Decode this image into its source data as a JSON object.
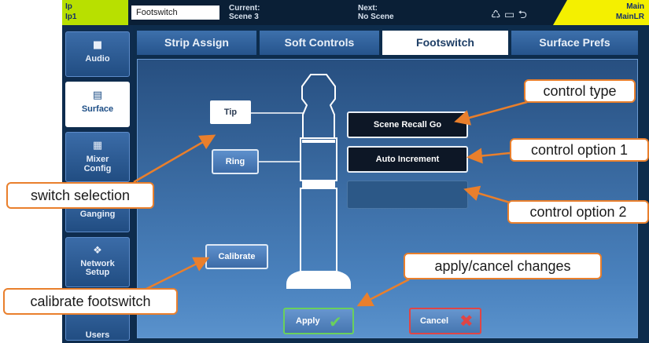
{
  "topbar": {
    "layer_top": "Ip",
    "layer_bottom": "Ip1",
    "screen_name": "Footswitch",
    "current_label": "Current:",
    "current_value": "Scene 3",
    "next_label": "Next:",
    "next_value": "No Scene",
    "status_icons": "♺ ▭ ⮌",
    "main_top": "Main",
    "main_bottom": "MainLR"
  },
  "nav": {
    "items": [
      {
        "label": "Audio",
        "icon": "audio-icon",
        "active": false
      },
      {
        "label": "Surface",
        "icon": "surface-icon",
        "active": true
      },
      {
        "label": "Mixer Config",
        "icon": "mixer-config-icon",
        "active": false
      },
      {
        "label": "Ganging",
        "icon": "ganging-icon",
        "active": false
      },
      {
        "label": "Network Setup",
        "icon": "network-icon",
        "active": false
      },
      {
        "label": "Users",
        "icon": "users-icon",
        "active": false
      }
    ]
  },
  "tabs": [
    {
      "label": "Strip Assign",
      "active": false
    },
    {
      "label": "Soft Controls",
      "active": false
    },
    {
      "label": "Footswitch",
      "active": true
    },
    {
      "label": "Surface Prefs",
      "active": false
    }
  ],
  "footswitch": {
    "tip_label": "Tip",
    "ring_label": "Ring",
    "calibrate_label": "Calibrate",
    "control_type_value": "Scene Recall Go",
    "control_option1_value": "Auto Increment",
    "control_option2_value": "",
    "apply_label": "Apply",
    "cancel_label": "Cancel"
  },
  "callouts": {
    "control_type": "control type",
    "control_option1": "control option 1",
    "control_option2": "control option 2",
    "switch_selection": "switch selection",
    "apply_cancel": "apply/cancel changes",
    "calibrate": "calibrate footswitch"
  },
  "colors": {
    "accent_green": "#b8e000",
    "accent_yellow": "#f4f000",
    "callout_border": "#e97f2c",
    "apply_check": "#6ad05c",
    "cancel_x": "#e04545"
  }
}
